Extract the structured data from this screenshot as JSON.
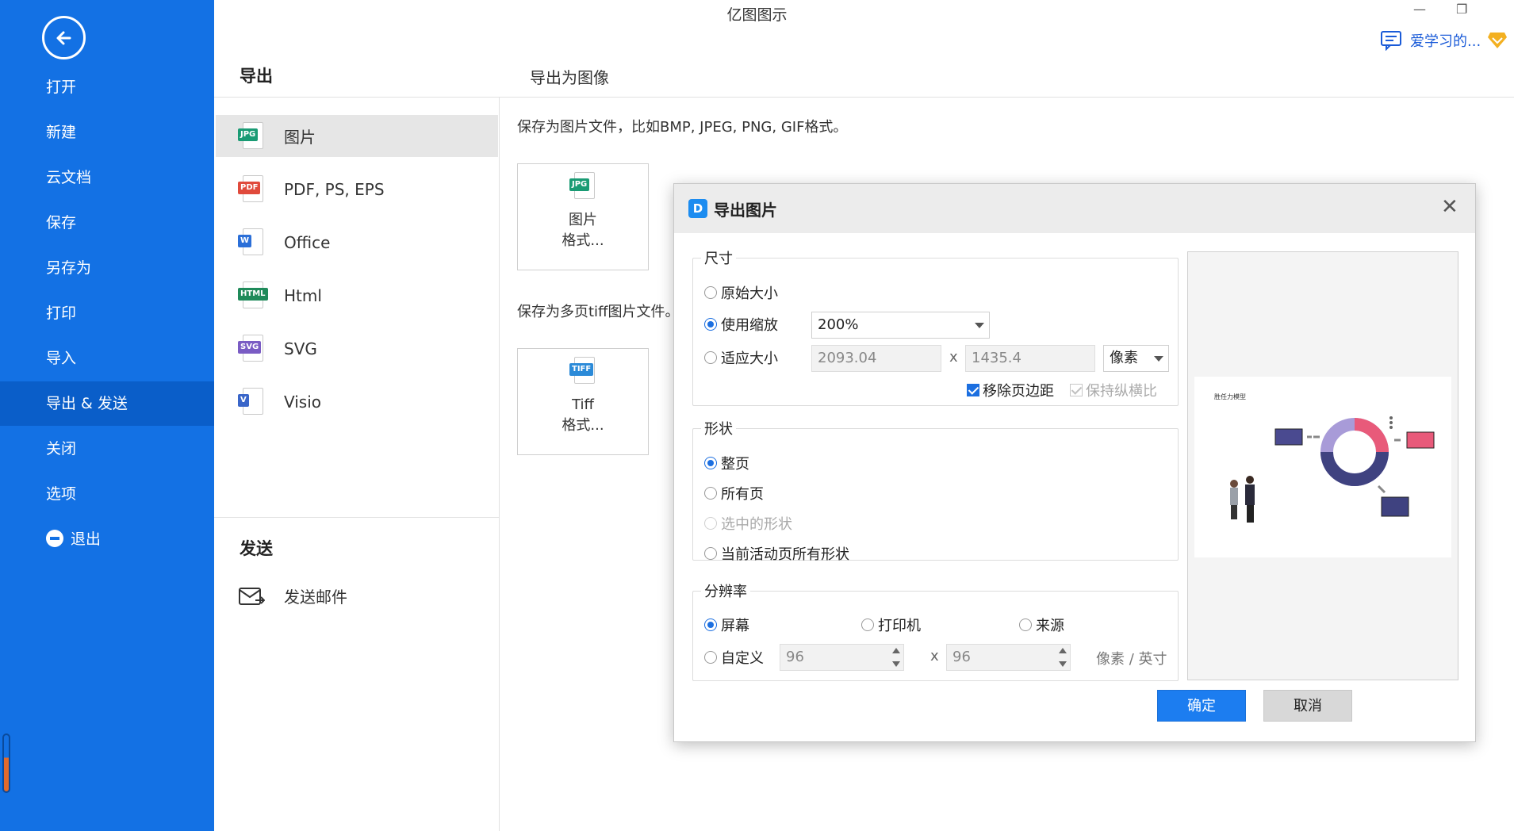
{
  "app": {
    "title": "亿图图示",
    "user_name": "爱学习的..."
  },
  "nav": {
    "items": [
      "打开",
      "新建",
      "云文档",
      "保存",
      "另存为",
      "打印",
      "导入",
      "导出 & 发送",
      "关闭",
      "选项"
    ],
    "active": "导出 & 发送",
    "exit_label": "退出"
  },
  "export_panel": {
    "title": "导出",
    "formats": [
      {
        "label": "图片",
        "tag": "JPG",
        "color": "#1a9b74"
      },
      {
        "label": "PDF, PS, EPS",
        "tag": "PDF",
        "color": "#e04a3c"
      },
      {
        "label": "Office",
        "tag": "W",
        "color": "#2b6fd8"
      },
      {
        "label": "Html",
        "tag": "HTML",
        "color": "#1f8a5a"
      },
      {
        "label": "SVG",
        "tag": "SVG",
        "color": "#7a5cc4"
      },
      {
        "label": "Visio",
        "tag": "V",
        "color": "#3a66c9"
      }
    ],
    "send_title": "发送",
    "send_email": "发送邮件"
  },
  "export_image": {
    "heading": "导出为图像",
    "desc_image": "保存为图片文件，比如BMP, JPEG, PNG, GIF格式。",
    "tile_image_line1": "图片",
    "tile_image_line2": "格式...",
    "desc_tiff": "保存为多页tiff图片文件。",
    "tile_tiff_line1": "Tiff",
    "tile_tiff_line2": "格式..."
  },
  "dialog": {
    "title": "导出图片",
    "size": {
      "legend": "尺寸",
      "original": "原始大小",
      "use_zoom": "使用缩放",
      "zoom_value": "200%",
      "fit_size": "适应大小",
      "width": "2093.04",
      "height": "1435.4",
      "unit": "像素",
      "times": "x",
      "remove_margin": "移除页边距",
      "keep_ratio": "保持纵横比"
    },
    "shape": {
      "legend": "形状",
      "whole_page": "整页",
      "all_pages": "所有页",
      "selected_shapes": "选中的形状",
      "current_page_shapes": "当前活动页所有形状"
    },
    "resolution": {
      "legend": "分辨率",
      "screen": "屏幕",
      "printer": "打印机",
      "source": "来源",
      "custom": "自定义",
      "dpi_x": "96",
      "dpi_y": "96",
      "times": "x",
      "unit": "像素 / 英寸"
    },
    "preview_caption": "胜任力模型",
    "ok": "确定",
    "cancel": "取消"
  }
}
